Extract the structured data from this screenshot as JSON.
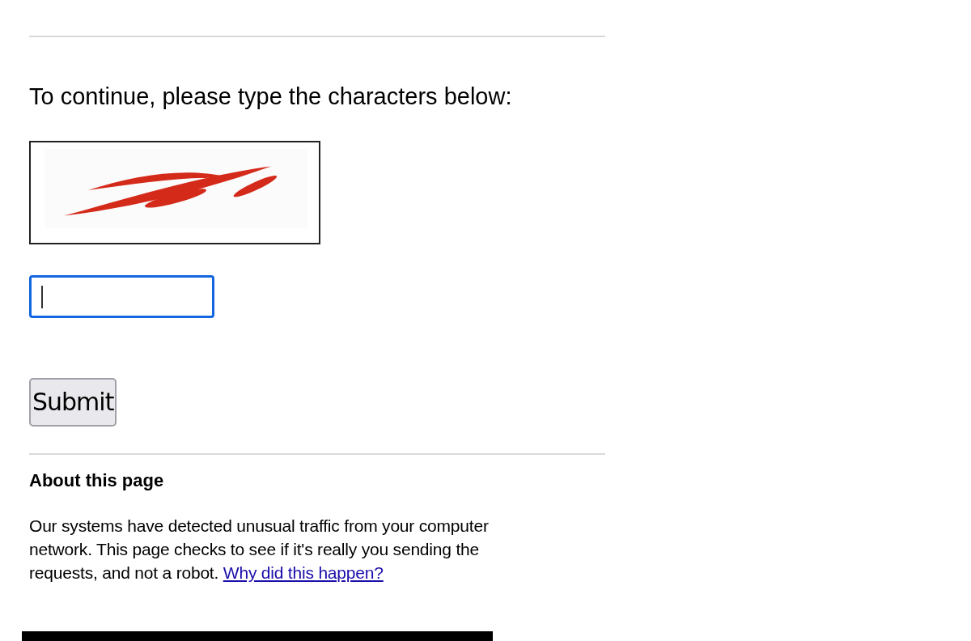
{
  "prompt": "To continue, please type the characters below:",
  "answer_field": {
    "focused": true
  },
  "submit_button": "Submit",
  "about": {
    "heading": "About this page",
    "text": "Our systems have detected unusual traffic from your computer network. This page checks to see if it's really you sending the requests, and not a robot.",
    "link": "Why did this happen?"
  }
}
